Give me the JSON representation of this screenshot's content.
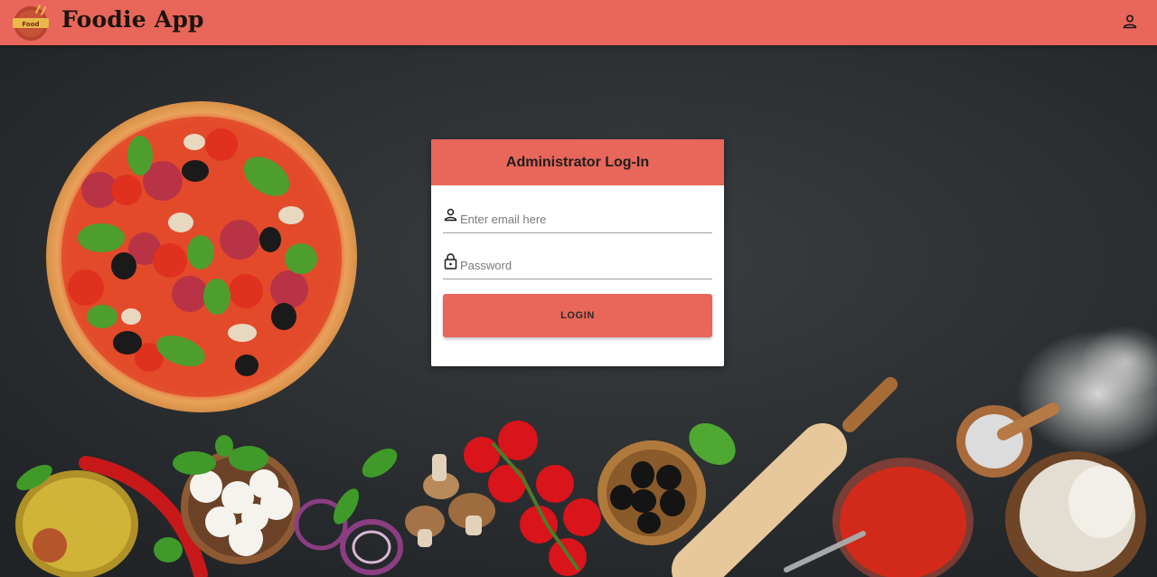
{
  "app": {
    "brand": "Foodie App",
    "logo_text": "Food",
    "user_icon": "person-icon"
  },
  "colors": {
    "primary": "#e8665a",
    "background": "#2b2e30",
    "card": "#ffffff"
  },
  "login": {
    "title": "Administrator Log-In",
    "email_placeholder": "Enter email here",
    "email_value": "",
    "password_placeholder": "Password",
    "password_value": "",
    "email_icon": "person-icon",
    "password_icon": "lock-icon",
    "submit_label": "LOGIN"
  }
}
